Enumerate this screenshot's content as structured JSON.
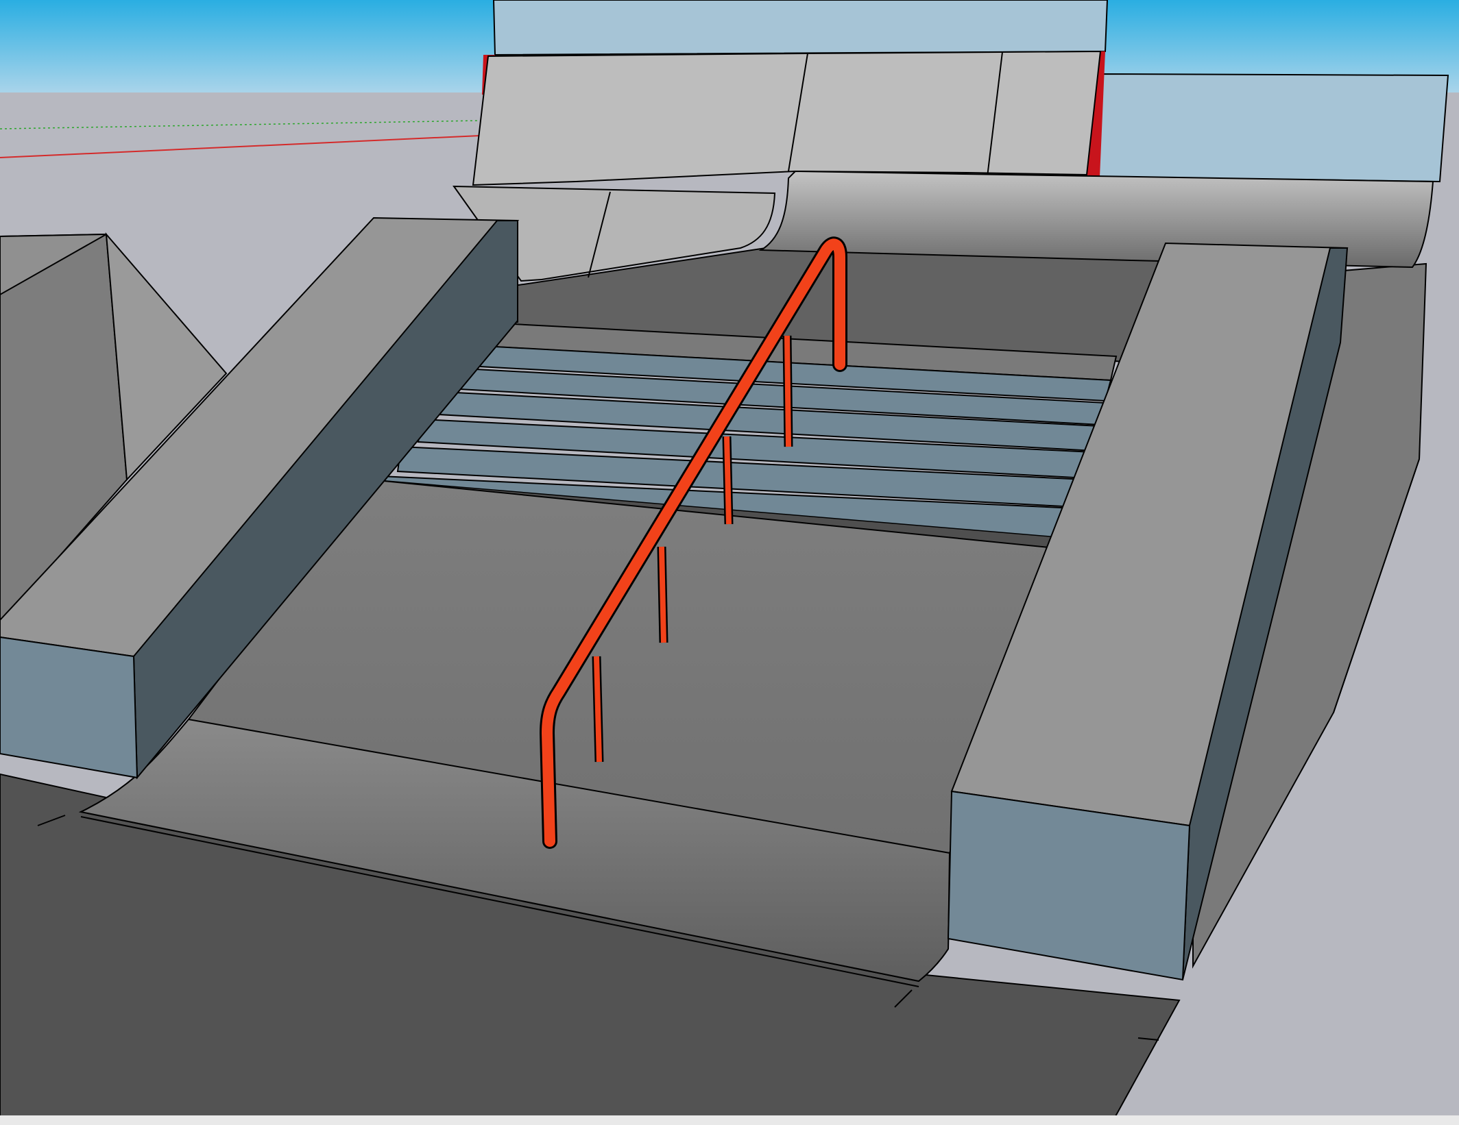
{
  "viewport": {
    "label": "",
    "colors": {
      "sky_top": "#2aaee2",
      "sky_bottom": "#a9d4ea",
      "ground": "#b7b8c0",
      "slab": "#535353",
      "ramp": "#7f7f7f",
      "deck": "#626262",
      "box_top": "#969696",
      "box_front": "#738997",
      "box_side": "#4a5860",
      "step": "#718896",
      "quarter_pipe": "#bdbdbd",
      "rail": "#f2421a",
      "axis_red": "#d42a2a",
      "axis_green": "#2aa52a",
      "outline": "#000000"
    },
    "objects": {
      "rail": "handrail",
      "stairs": "stair-set",
      "left_box": "ledge-box",
      "right_box": "ledge-box",
      "back_ramp": "quarter-pipe"
    }
  }
}
